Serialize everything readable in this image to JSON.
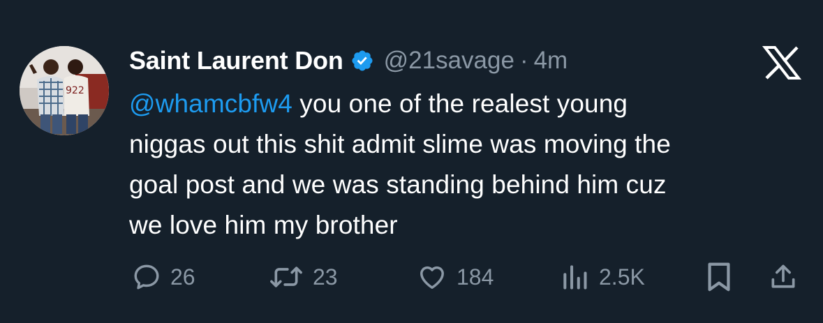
{
  "tweet": {
    "author": {
      "display_name": "Saint Laurent Don",
      "handle": "@21savage",
      "verified": true,
      "avatar_icon": "profile-photo"
    },
    "separator": "·",
    "time": "4m",
    "platform_icon": "x-logo-icon",
    "body": {
      "mention": "@whamcbfw4",
      "line1_rest": " you one of the realest young",
      "line2": "niggas out this shit admit slime was moving the",
      "line3": "goal post and we was standing behind him cuz",
      "line4": "we love him my brother"
    },
    "stats": {
      "replies": "26",
      "reposts": "23",
      "likes": "184",
      "views": "2.5K"
    },
    "icons": {
      "reply": "reply-icon",
      "repost": "repost-icon",
      "like": "heart-icon",
      "views": "views-icon",
      "bookmark": "bookmark-icon",
      "share": "share-icon"
    },
    "colors": {
      "background": "#15202b",
      "text": "#ffffff",
      "muted": "#8b98a5",
      "link": "#1d9bf0",
      "verified_badge": "#1d9bf0"
    }
  }
}
